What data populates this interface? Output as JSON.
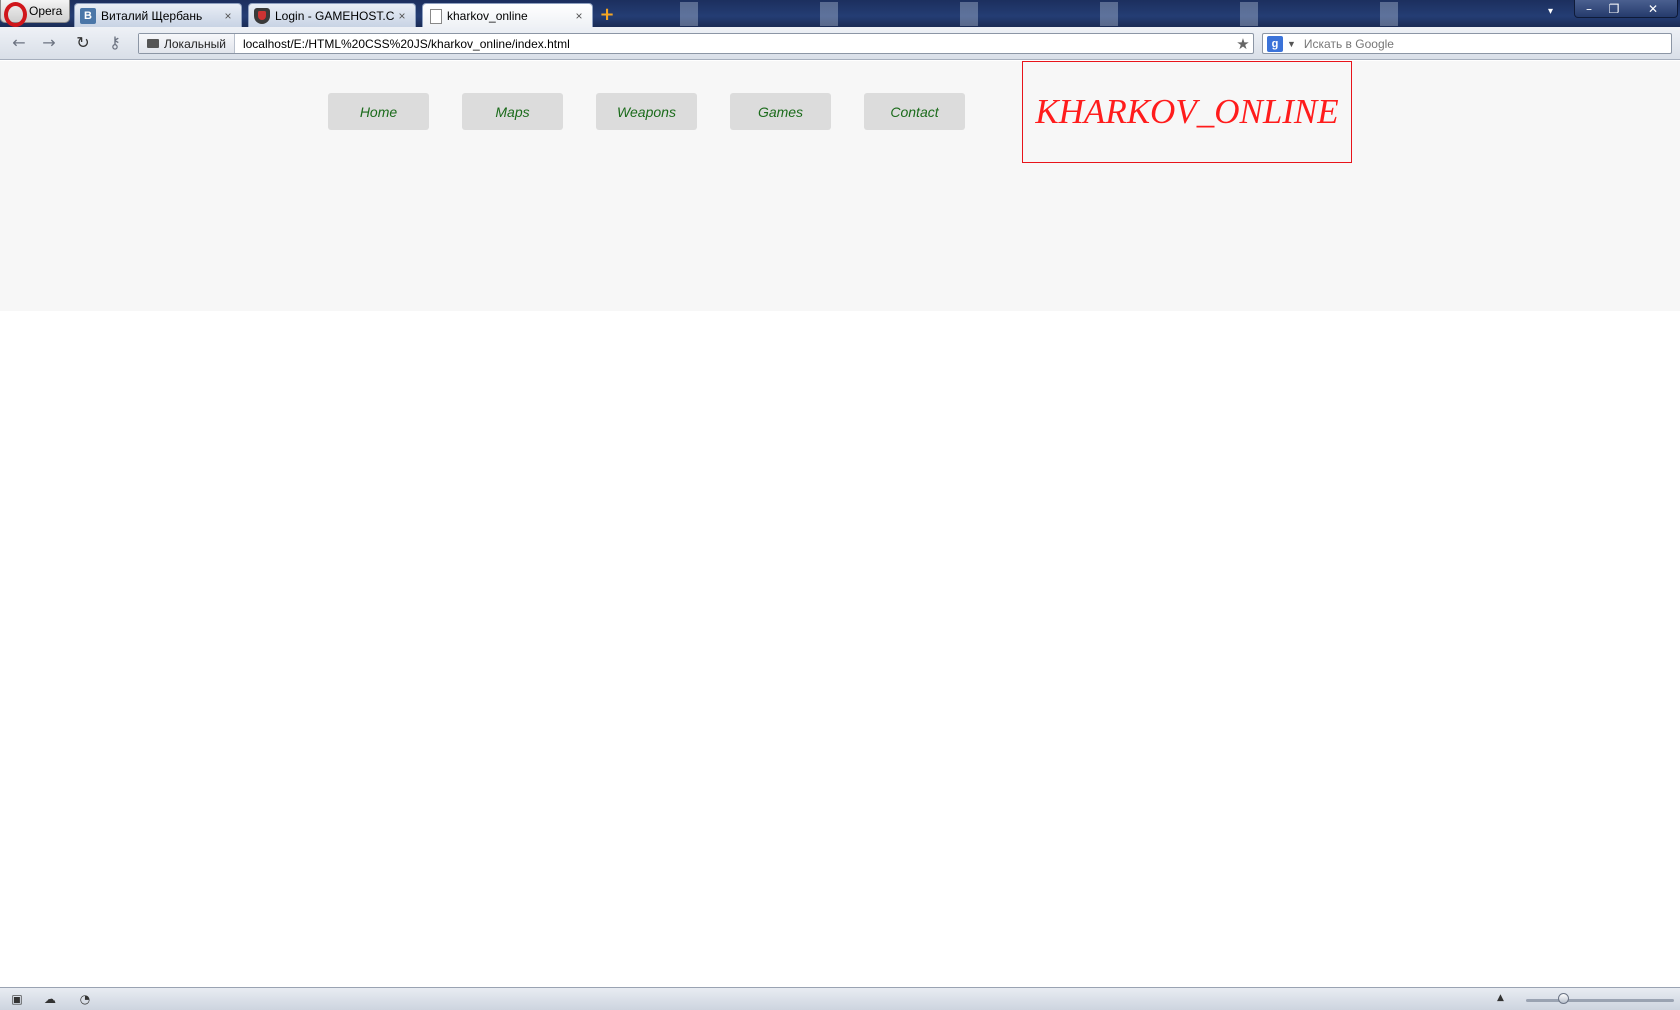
{
  "browser": {
    "menu_label": "Opera",
    "tabs": [
      {
        "title": "Виталий Щербань",
        "favicon": "vk-icon"
      },
      {
        "title": "Login - GAMEHOST.CO...",
        "favicon": "shield-icon"
      },
      {
        "title": "kharkov_online",
        "favicon": "page-icon"
      }
    ],
    "close_glyph": "×",
    "address": {
      "badge": "Локальный",
      "url": "localhost/E:/HTML%20CSS%20JS/kharkov_online/index.html"
    },
    "search": {
      "engine_letter": "g",
      "placeholder": "Искать в Google"
    }
  },
  "page": {
    "nav": [
      {
        "label": "Home"
      },
      {
        "label": "Maps"
      },
      {
        "label": "Weapons"
      },
      {
        "label": "Games"
      },
      {
        "label": "Contact"
      }
    ],
    "logo_text": "KHARKOV_ONLINE"
  },
  "status": {
    "zoom_level": 0.25
  },
  "colors": {
    "nav_text": "#1b6b1b",
    "nav_bg": "#dcdcdc",
    "logo": "#ff1c1c",
    "header_bg": "#f7f7f7"
  }
}
